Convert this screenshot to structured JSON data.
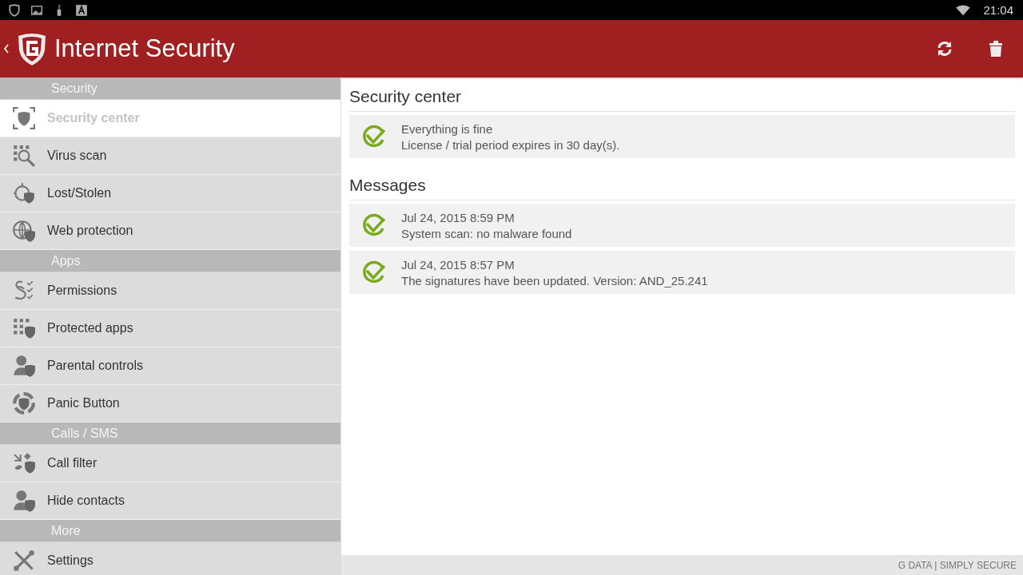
{
  "status_bar": {
    "time": "21:04"
  },
  "app_bar": {
    "title": "Internet Security"
  },
  "sidebar": {
    "sections": [
      {
        "title": "Security",
        "items": [
          {
            "label": "Security center",
            "kind": "shield",
            "selected": true
          },
          {
            "label": "Virus scan",
            "kind": "scan",
            "selected": false
          },
          {
            "label": "Lost/Stolen",
            "kind": "target",
            "selected": false
          },
          {
            "label": "Web protection",
            "kind": "globe",
            "selected": false
          }
        ]
      },
      {
        "title": "Apps",
        "items": [
          {
            "label": "Permissions",
            "kind": "checklist",
            "selected": false
          },
          {
            "label": "Protected apps",
            "kind": "grid",
            "selected": false
          },
          {
            "label": "Parental controls",
            "kind": "child",
            "selected": false
          },
          {
            "label": "Panic Button",
            "kind": "ring",
            "selected": false
          }
        ]
      },
      {
        "title": "Calls / SMS",
        "items": [
          {
            "label": "Call filter",
            "kind": "arrows",
            "selected": false
          },
          {
            "label": "Hide contacts",
            "kind": "person",
            "selected": false
          }
        ]
      },
      {
        "title": "More",
        "items": [
          {
            "label": "Settings",
            "kind": "tools",
            "selected": false
          }
        ]
      }
    ]
  },
  "content": {
    "sections": [
      {
        "title": "Security center",
        "cards": [
          {
            "line1": "Everything is fine",
            "line2": "License / trial period expires in 30 day(s)."
          }
        ]
      },
      {
        "title": "Messages",
        "cards": [
          {
            "line1": "Jul 24, 2015 8:59 PM",
            "line2": "System scan: no malware found"
          },
          {
            "line1": "Jul 24, 2015 8:57 PM",
            "line2": "The signatures have been updated. Version: AND_25.241"
          }
        ]
      }
    ]
  },
  "footer": {
    "text": "G DATA | SIMPLY SECURE"
  }
}
